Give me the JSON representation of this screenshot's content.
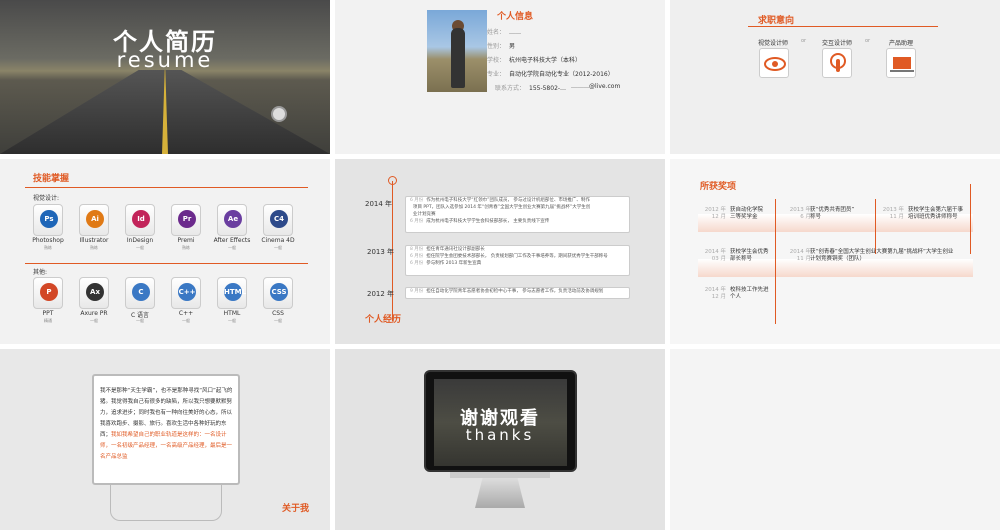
{
  "cover": {
    "title_cn": "个人简历",
    "title_en": "resume"
  },
  "profile": {
    "section_title": "个人信息",
    "rows": [
      {
        "label": "姓名：",
        "value": "……"
      },
      {
        "label": "性别：",
        "value": "男"
      },
      {
        "label": "学校：",
        "value": "杭州电子科技大学（本科）"
      },
      {
        "label": "专业：",
        "value": "自动化学院自动化专业（2012-2016）"
      },
      {
        "label": "联系方式：",
        "value": "155-5802-…"
      },
      {
        "label": "",
        "value": "………@live.com"
      }
    ]
  },
  "intent": {
    "section_title": "求职意向",
    "items": [
      "视觉设计师",
      "交互设计师",
      "产品助理"
    ],
    "sep": "or"
  },
  "skills": {
    "section_title": "技能掌握",
    "group1_label": "视觉设计:",
    "group1": [
      {
        "icon": "Ps",
        "name": "Photoshop",
        "level": "熟练",
        "color": "#1e66b8"
      },
      {
        "icon": "Ai",
        "name": "Illustrator",
        "level": "熟练",
        "color": "#e07a16"
      },
      {
        "icon": "Id",
        "name": "InDesign",
        "level": "一般",
        "color": "#c2245a"
      },
      {
        "icon": "Pr",
        "name": "Premi",
        "level": "熟练",
        "color": "#6b2a8c"
      },
      {
        "icon": "Ae",
        "name": "After Effects",
        "level": "一般",
        "color": "#6a3ea0"
      },
      {
        "icon": "C4",
        "name": "Cinema 4D",
        "level": "一般",
        "color": "#2d4a8a"
      }
    ],
    "group2_label": "其他:",
    "group2": [
      {
        "icon": "P",
        "name": "PPT",
        "level": "精通",
        "color": "#d24726"
      },
      {
        "icon": "Ax",
        "name": "Axure PR",
        "level": "一般",
        "color": "#333333"
      },
      {
        "icon": "C",
        "name": "C 语言",
        "level": "一般",
        "color": "#3a78c4"
      },
      {
        "icon": "C++",
        "name": "C++",
        "level": "一般",
        "color": "#3a78c4"
      },
      {
        "icon": "HTML",
        "name": "HTML",
        "level": "一般",
        "color": "#3a78c4"
      },
      {
        "icon": "CSS",
        "name": "CSS",
        "level": "一般",
        "color": "#3a78c4"
      }
    ]
  },
  "experience": {
    "section_title": "个人经历",
    "years": [
      "2014 年",
      "2013 年",
      "2012 年"
    ],
    "box1": [
      {
        "m": "6 月份",
        "t": "作为杭州电子科技大学“红领巾”团队成员，  参与过设计机组部位、市场推广、制作"
      },
      {
        "m": "",
        "t": "项目 PPT，团队入选参加 2014 年“创青春”全国大学生创业大赛第九届“挑战杯”大学生创"
      },
      {
        "m": "",
        "t": "业计划竞赛"
      },
      {
        "m": "6 月份",
        "t": "成为杭州电子科技大学学生会科技部部长，  主要负责线下宣传"
      }
    ],
    "box2": [
      {
        "m": "8 月份",
        "t": "担任青年通讯社设计部副部长"
      },
      {
        "m": "6 月份",
        "t": "担任院学生会团委技术部部长，  负责规划部门工作及干事培养等，期间获优秀学生干部称号"
      },
      {
        "m": "6 月份",
        "t": "参与制作 2013 年新生宣典"
      }
    ],
    "box3": [
      {
        "m": "9 月份",
        "t": "担任自动化学院青年志愿者协会初检中心干事，  参与志愿者工作，负责活动前及协调规划"
      }
    ]
  },
  "awards": {
    "section_title": "所获奖项",
    "row1": [
      {
        "date": "2012 年\n12 月",
        "text": "获自动化学院\n三等奖学金"
      },
      {
        "date": "2013 年\n6 月",
        "text": "获“优秀共青团员”\n称号"
      },
      {
        "date": "2013 年\n11 月",
        "text": "获校学生会第六届干事\n培训班优秀讲师称号"
      }
    ],
    "row2": [
      {
        "date": "2014 年\n03 月",
        "text": "获校学生会优秀\n部长称号"
      },
      {
        "date": "2014 年\n11 月",
        "text": "获“创青春”全国大学生创业大赛第九届“挑战杯”大学生创业\n计划竞赛铜奖（团队）"
      }
    ],
    "row3": [
      {
        "date": "2014 年\n12 月",
        "text": "校科技工作先进\n个人"
      }
    ]
  },
  "about": {
    "section_title": "关于我",
    "text_black": "我不是那种“天生学霸”，也不是那种寻找“风口”起飞的猪。我觉得我自己有很多的缺陷，所以我只想要默默努力，追求进步；同时我也有一种向往美好的心态，所以我喜欢跑步、摄影、旅行。喜欢生活中各种好玩的东西；",
    "text_orange": "我如我希望自己的职业轨道是这样的：一名设计师，一名初级产品经理，一名高级产品经理，最后是一名产品总监"
  },
  "thanks": {
    "title_cn": "谢谢观看",
    "title_en": "thanks"
  },
  "colors": {
    "accent": "#e05a24",
    "slide_bg": "#f2f2f2"
  }
}
